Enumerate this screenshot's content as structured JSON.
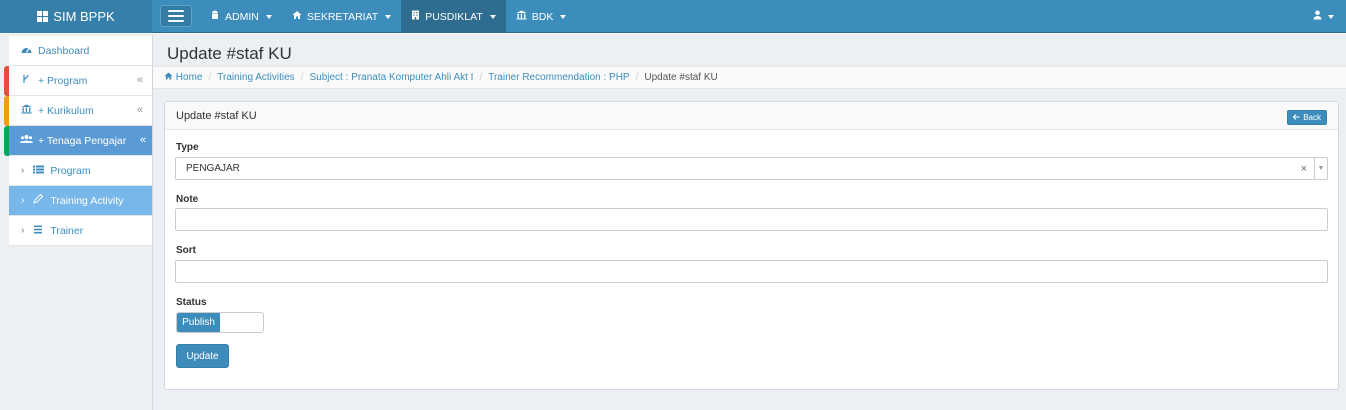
{
  "navbar": {
    "brand": "SIM BPPK",
    "menus": [
      {
        "label": "ADMIN",
        "icon": "android-icon"
      },
      {
        "label": "SEKRETARIAT",
        "icon": "home-icon"
      },
      {
        "label": "PUSDIKLAT",
        "icon": "building-icon"
      },
      {
        "label": "BDK",
        "icon": "institution-icon"
      }
    ],
    "user_icon": "user-icon"
  },
  "sidebar": {
    "items": [
      {
        "label": "Dashboard",
        "icon": "dashboard-icon"
      },
      {
        "label": "+ Program",
        "icon": "fork-icon",
        "stripe": "#e74c3c"
      },
      {
        "label": "+ Kurikulum",
        "icon": "institution-icon",
        "stripe": "#f39c12"
      },
      {
        "label": "+ Tenaga Pengajar",
        "icon": "users-icon",
        "stripe": "#00a65a"
      },
      {
        "label": "Program",
        "icon": "list-icon"
      },
      {
        "label": "Training Activity",
        "icon": "pencil-icon"
      },
      {
        "label": "Trainer",
        "icon": "bars-icon"
      }
    ],
    "collapse_glyph": "«",
    "sub_arrow": "›"
  },
  "page": {
    "title": "Update #staf KU",
    "breadcrumb": [
      "Home",
      "Training Activities",
      "Subject : Pranata Komputer Ahli Akt I",
      "Trainer Recommendation : PHP",
      "Update #staf KU"
    ],
    "breadcrumb_sep": "/"
  },
  "form": {
    "box_title": "Update #staf KU",
    "back_label": "Back",
    "type_label": "Type",
    "type_value": "PENGAJAR",
    "type_clear": "×",
    "note_label": "Note",
    "note_value": "",
    "sort_label": "Sort",
    "sort_value": "",
    "status_label": "Status",
    "status_value": "Publish",
    "submit_label": "Update"
  },
  "colors": {
    "primary": "#3c8dbc",
    "navbar_dark": "#367fa9",
    "active_item": "#5b9bd5",
    "active_sub": "#78b7ea",
    "background": "#ecf0f5"
  }
}
